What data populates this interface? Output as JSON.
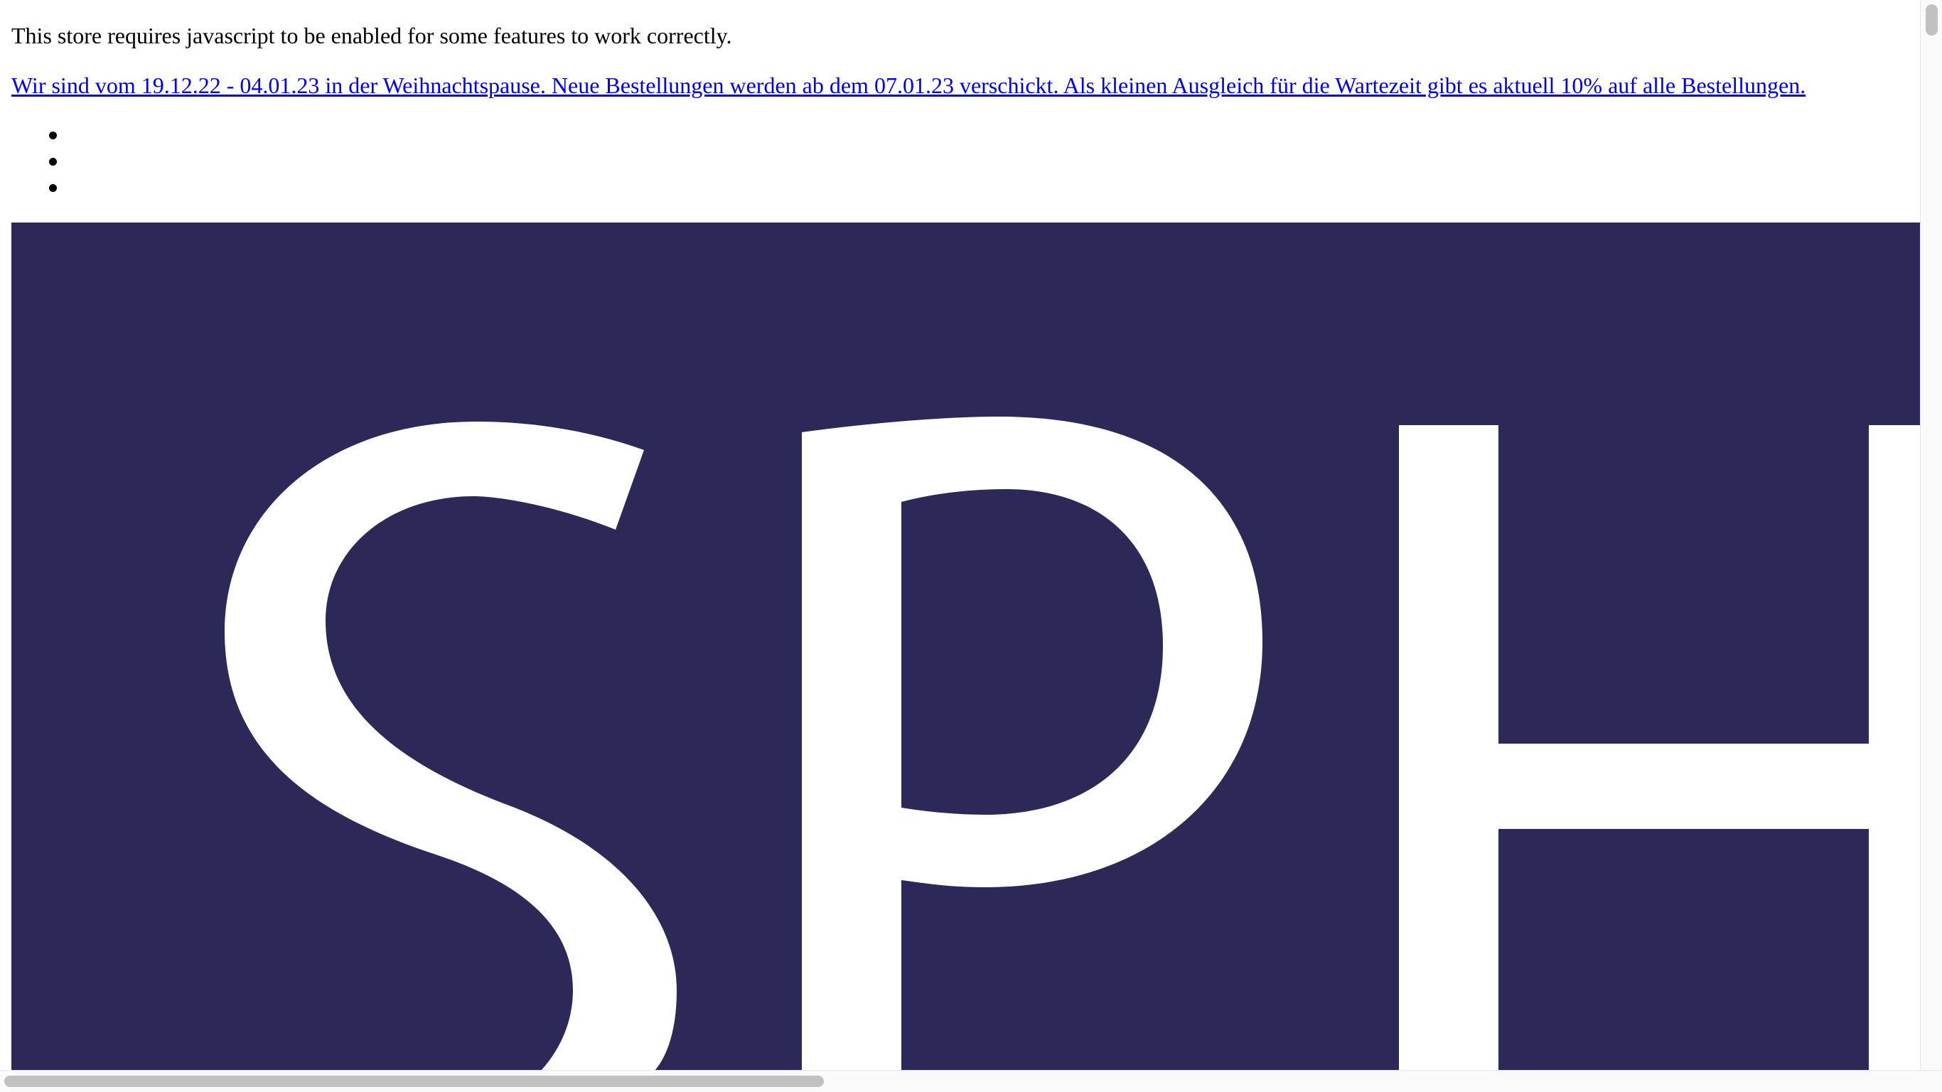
{
  "noscript": {
    "message": "This store requires javascript to be enabled for some features to work correctly."
  },
  "announcement": {
    "link_text": "Wir sind vom 19.12.22 - 04.01.23 in der Weihnachtspause. Neue Bestellungen werden ab dem 07.01.23 verschickt. Als kleinen Ausgleich für die Wartezeit gibt es aktuell 10% auf alle Bestellungen."
  },
  "nav": {
    "items": [
      "",
      "",
      ""
    ]
  },
  "logo": {
    "visible_letters": "SPH",
    "background_color": "#2c2857",
    "letter_color": "#ffffff"
  }
}
